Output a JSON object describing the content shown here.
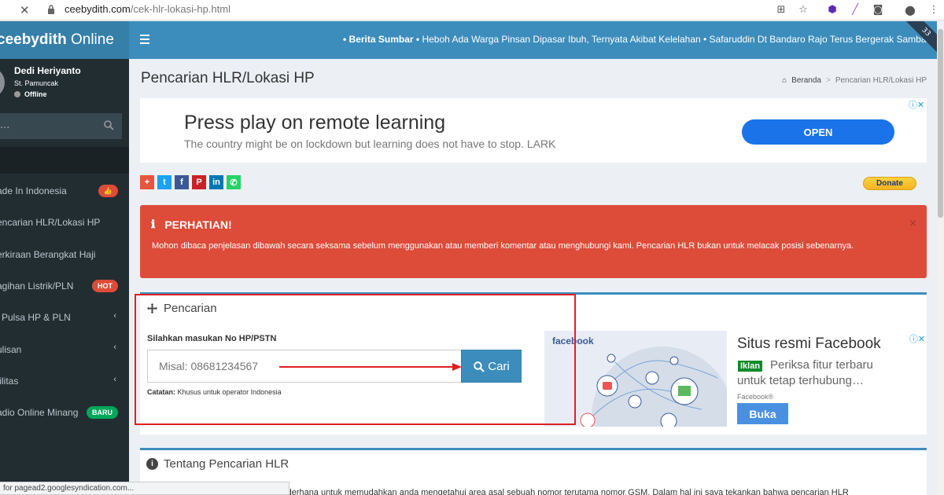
{
  "browser": {
    "url_domain": "ceebydith.com",
    "url_path": "/cek-hlr-lokasi-hp.html",
    "status_text": "for pagead2.googlesyndication.com..."
  },
  "sidebar": {
    "logo_bold": "ceebydith",
    "logo_rest": " Online",
    "user_name": "Dedi Heriyanto",
    "user_title": "St. Pamuncak",
    "user_status": "Offline",
    "search_text": "...",
    "items": [
      {
        "label": "ade In Indonesia",
        "badge": "👍",
        "badge_color": "#dd4b39"
      },
      {
        "label": "encarian HLR/Lokasi HP"
      },
      {
        "label": "erkiraan Berangkat Haji"
      },
      {
        "label": "agihan Listrik/PLN",
        "badge": "HOT",
        "badge_color": "#dd4b39"
      },
      {
        "label": "i Pulsa HP & PLN",
        "chevron": "‹"
      },
      {
        "label": "ulisan",
        "chevron": "‹"
      },
      {
        "label": "tilitas",
        "chevron": "‹"
      },
      {
        "label": "adio Online Minang",
        "badge": "BARU",
        "badge_color": "#00a65a"
      }
    ]
  },
  "topbar": {
    "ticker_label": "• Berita Sumbar •",
    "ticker_text": " Heboh Ada Warga Pinsan Dipasar Ibuh, Ternyata Akibat Kelelahan • Safaruddin Dt Bandaro Rajo Terus Bergerak Sambari",
    "ribbon_text": "33"
  },
  "page": {
    "title": "Pencarian HLR/Lokasi HP",
    "breadcrumb_home": "Beranda",
    "breadcrumb_current": "Pencarian HLR/Lokasi HP"
  },
  "ad1": {
    "headline": "Press play on remote learning",
    "sub": "The country might be on lockdown but learning does not have to stop. LARK",
    "button": "OPEN"
  },
  "donate": "Donate",
  "alert": {
    "title": "PERHATIAN!",
    "text": "Mohon dibaca penjelasan dibawah secara seksama sebelum menggunakan atau memberi komentar atau menghubungi kami. Pencarian HLR bukan untuk melacak posisi sebenarnya.",
    "close": "×"
  },
  "search_box": {
    "title": "Pencarian",
    "label": "Silahkan masukan No HP/PSTN",
    "placeholder": "Misal: 08681234567",
    "button": "Cari",
    "note_bold": "Catatan:",
    "note": " Khusus untuk operator Indonesia"
  },
  "ad2": {
    "logo": "facebook",
    "headline": "Situs resmi Facebook",
    "badge": "Iklan",
    "desc1": "Periksa fitur terbaru",
    "desc2": "untuk tetap terhubung…",
    "source": "Facebook®",
    "button": "Buka"
  },
  "about_box": {
    "title": "Tentang Pencarian HLR",
    "text": "si sederhana untuk memudahkan anda mengetahui area asal sebuah nomor terutama nomor GSM. Dalam hal ini saya tekankan bahwa pencarian HLR"
  }
}
